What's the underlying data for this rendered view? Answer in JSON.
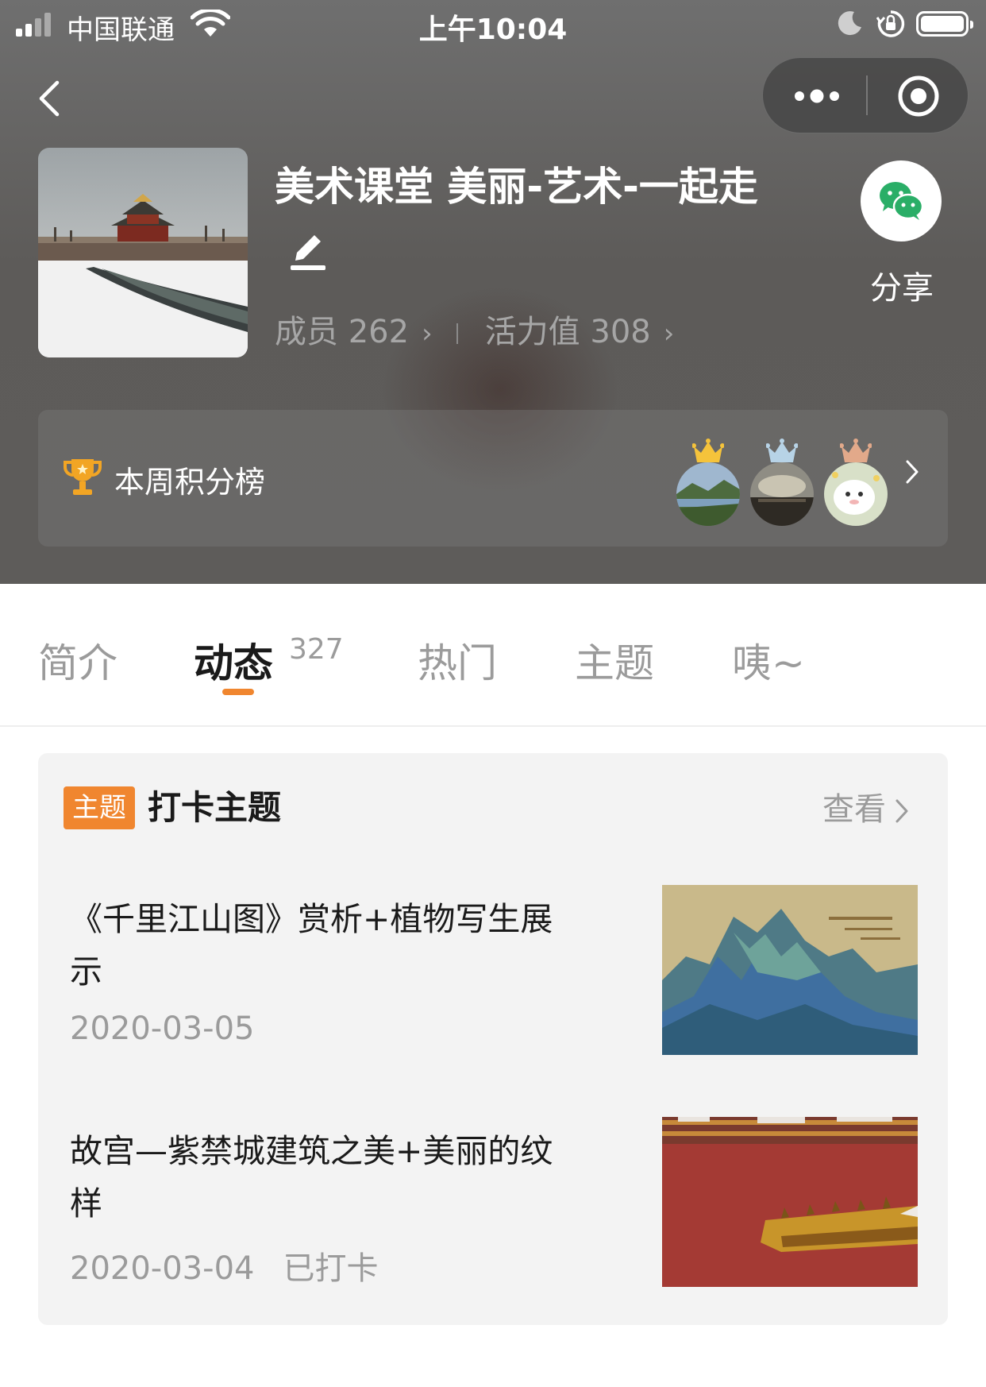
{
  "status_bar": {
    "carrier": "中国联通",
    "time": "上午10:04"
  },
  "group": {
    "title": "美术课堂 美丽-艺术-一起走",
    "members_label": "成员",
    "members_count": "262",
    "vitality_label": "活力值",
    "vitality_value": "308",
    "share_label": "分享"
  },
  "leaderboard": {
    "title": "本周积分榜",
    "crown_colors": [
      "#f5c33b",
      "#b7d3e6",
      "#e2a98a"
    ]
  },
  "tabs": [
    {
      "label": "简介",
      "active": false
    },
    {
      "label": "动态",
      "active": true,
      "count": "327"
    },
    {
      "label": "热门",
      "active": false
    },
    {
      "label": "主题",
      "active": false
    },
    {
      "label": "咦~",
      "active": false
    }
  ],
  "topics": {
    "tag": "主题",
    "heading": "打卡主题",
    "view_label": "查看",
    "items": [
      {
        "title": "《千里江山图》赏析+植物写生展示",
        "date": "2020-03-05",
        "status": ""
      },
      {
        "title": "故宫—紫禁城建筑之美+美丽的纹样",
        "date": "2020-03-04",
        "status": "已打卡"
      }
    ]
  },
  "colors": {
    "accent": "#f0862f",
    "wechat_green": "#2aae67"
  }
}
